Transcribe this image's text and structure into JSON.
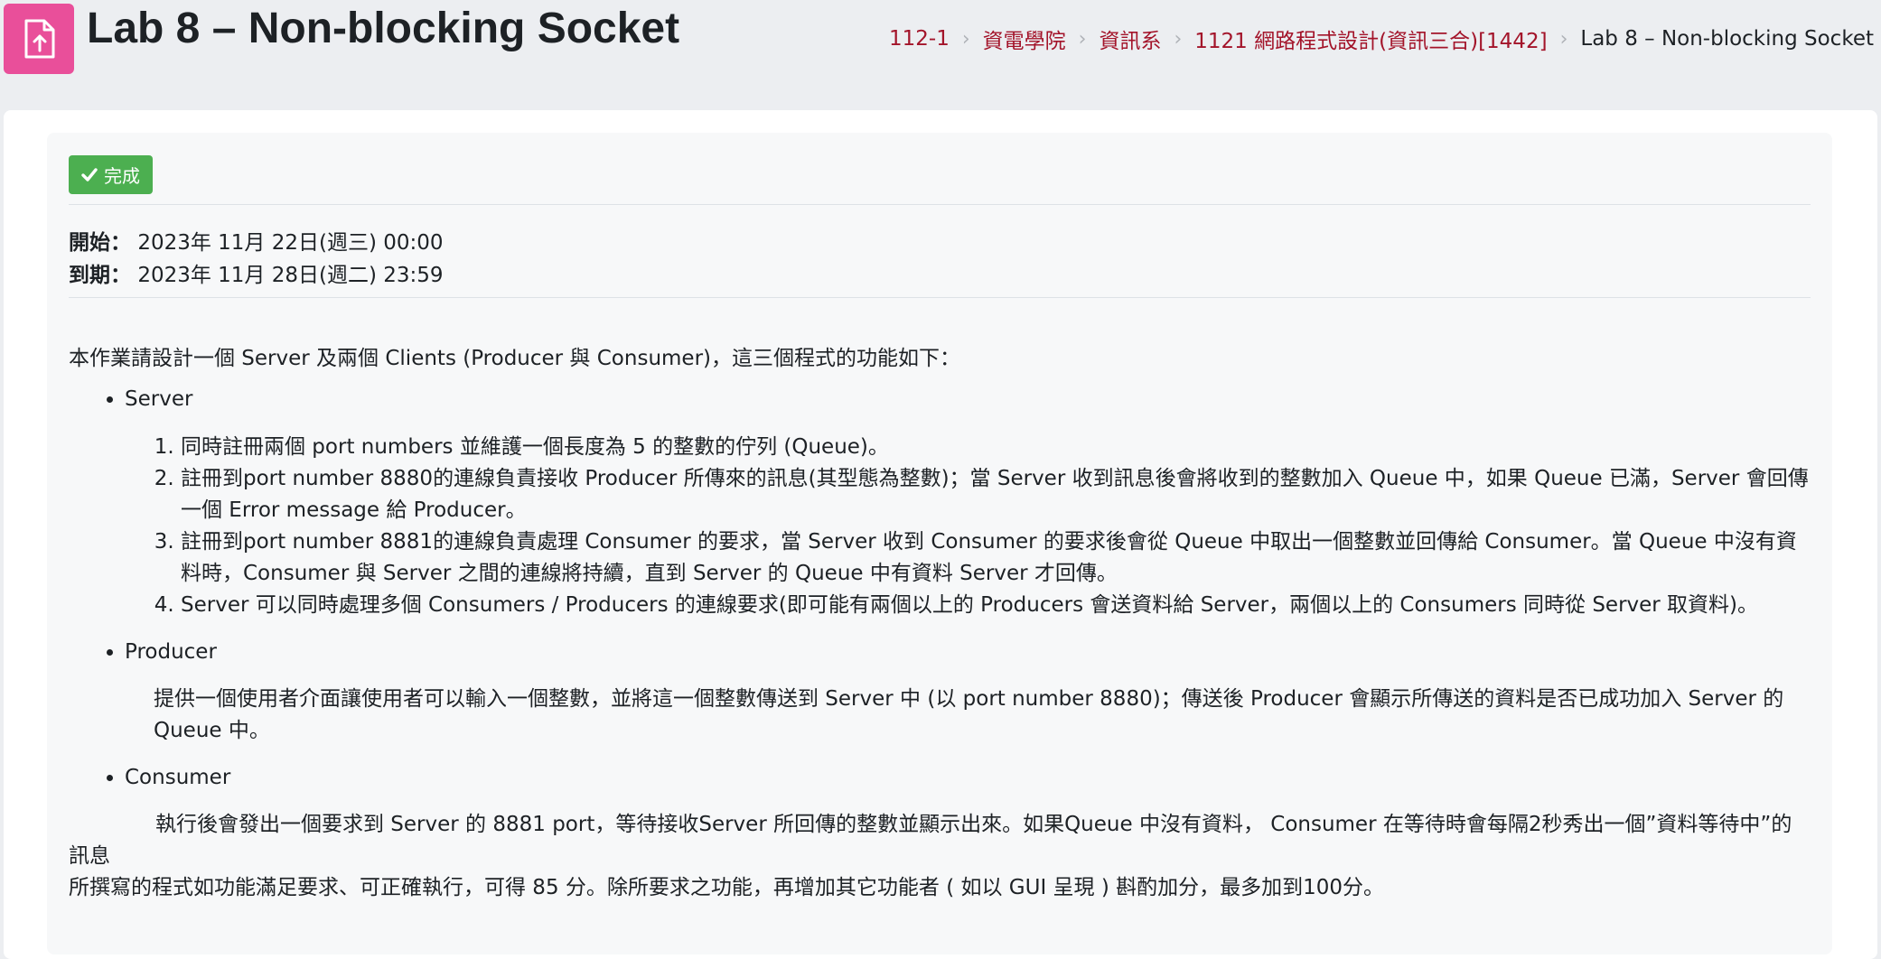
{
  "header": {
    "title": "Lab 8 – Non-blocking Socket",
    "icon": "assignment-upload-icon",
    "icon_color": "#e94f9a",
    "breadcrumb": [
      {
        "label": "112-1",
        "link": true
      },
      {
        "label": "資電學院",
        "link": true
      },
      {
        "label": "資訊系",
        "link": true
      },
      {
        "label": "1121 網路程式設計(資訊三合)[1442]",
        "link": true
      },
      {
        "label": "Lab 8 – Non-blocking Socket",
        "link": false
      }
    ]
  },
  "completion": {
    "label": "完成",
    "icon": "check-icon",
    "color": "#4caf50"
  },
  "dates": {
    "open_label": "開始：",
    "open_value": "2023年 11月 22日(週三) 00:00",
    "due_label": "到期：",
    "due_value": "2023年 11月 28日(週二) 23:59"
  },
  "description": {
    "intro": "本作業請設計一個 Server 及兩個 Clients (Producer 與 Consumer)，這三個程式的功能如下：",
    "server": {
      "title": "Server",
      "items": [
        "同時註冊兩個 port numbers 並維護一個長度為 5 的整數的佇列 (Queue)。",
        "註冊到port number 8880的連線負責接收 Producer 所傳來的訊息(其型態為整數)；當 Server 收到訊息後會將收到的整數加入 Queue 中，如果 Queue 已滿，Server 會回傳一個 Error message 給 Producer。",
        "註冊到port number 8881的連線負責處理 Consumer 的要求，當 Server 收到 Consumer 的要求後會從 Queue 中取出一個整數並回傳給 Consumer。當 Queue 中沒有資料時，Consumer 與 Server 之間的連線將持續，直到 Server 的 Queue 中有資料 Server 才回傳。",
        "Server 可以同時處理多個 Consumers / Producers 的連線要求(即可能有兩個以上的 Producers 會送資料給 Server，兩個以上的 Consumers 同時從 Server 取資料)。"
      ]
    },
    "producer": {
      "title": "Producer",
      "text": "提供一個使用者介面讓使用者可以輸入一個整數，並將這一個整數傳送到 Server 中 (以 port number 8880)；傳送後 Producer 會顯示所傳送的資料是否已成功加入 Server 的 Queue 中。"
    },
    "consumer": {
      "title": "Consumer",
      "text": "執行後會發出一個要求到 Server 的 8881 port，等待接收Server 所回傳的整數並顯示出來。如果Queue 中沒有資料， Consumer 在等待時會每隔2秒秀出一個”資料等待中”的訊息"
    },
    "grading": "所撰寫的程式如功能滿足要求、可正確執行，可得 85 分。除所要求之功能，再增加其它功能者 ( 如以 GUI 呈現 ) 斟酌加分，最多加到100分。"
  }
}
